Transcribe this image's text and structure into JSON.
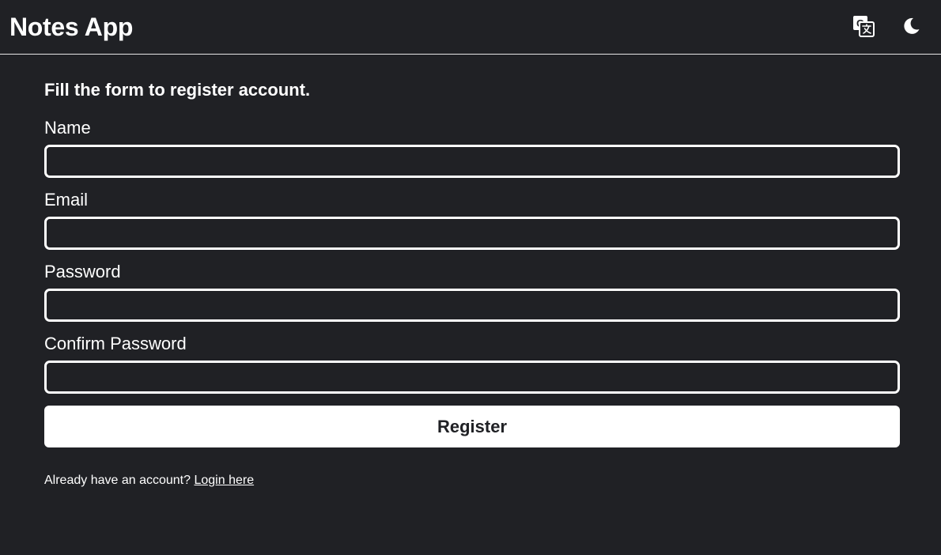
{
  "header": {
    "title": "Notes App",
    "translate_icon": "translate-icon",
    "theme_icon": "moon-icon"
  },
  "form": {
    "heading": "Fill the form to register account.",
    "fields": [
      {
        "label": "Name",
        "value": "",
        "placeholder": ""
      },
      {
        "label": "Email",
        "value": "",
        "placeholder": ""
      },
      {
        "label": "Password",
        "value": "",
        "placeholder": ""
      },
      {
        "label": "Confirm Password",
        "value": "",
        "placeholder": ""
      }
    ],
    "submit_label": "Register"
  },
  "footer": {
    "prompt": "Already have an account?",
    "link_label": "Login here"
  },
  "colors": {
    "background": "#202125",
    "foreground": "#ffffff",
    "button_text": "#202125"
  }
}
